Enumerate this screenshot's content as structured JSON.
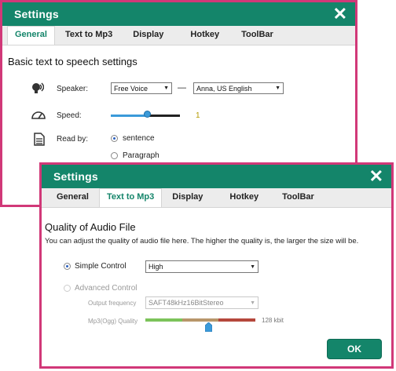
{
  "window1": {
    "title": "Settings",
    "tabs": [
      "General",
      "Text to Mp3",
      "Display",
      "Hotkey",
      "ToolBar"
    ],
    "heading": "Basic text to speech settings",
    "speaker_label": "Speaker:",
    "speaker_engine": "Free Voice",
    "speaker_separator": "—",
    "speaker_voice": "Anna, US English",
    "speed_label": "Speed:",
    "speed_value": "1",
    "speed_level": 0.6,
    "readby_label": "Read by:",
    "readby_options": [
      "sentence",
      "Paragraph"
    ],
    "readby_selected": "sentence"
  },
  "window2": {
    "title": "Settings",
    "tabs": [
      "General",
      "Text to Mp3",
      "Display",
      "Hotkey",
      "ToolBar"
    ],
    "heading": "Quality of Audio File",
    "description": "You can adjust the quality of audio file here. The higher the quality  is, the larger the size will be.",
    "simple_control_label": "Simple Control",
    "simple_control_value": "High",
    "advanced_control_label": "Advanced Control",
    "output_frequency_label": "Output frequency",
    "output_frequency_value": "SAFT48kHz16BitStereo",
    "mp3_quality_label": "Mp3(Ogg) Quality",
    "mp3_quality_value": "128 kbit",
    "mp3_quality_level": 0.58,
    "ok_label": "OK"
  },
  "colors": {
    "accent": "#14856a",
    "border": "#d13878",
    "slider_green": "#7cc35a",
    "slider_tan": "#b8966a",
    "slider_red": "#b5473c",
    "thumb": "#3b9ad9"
  }
}
